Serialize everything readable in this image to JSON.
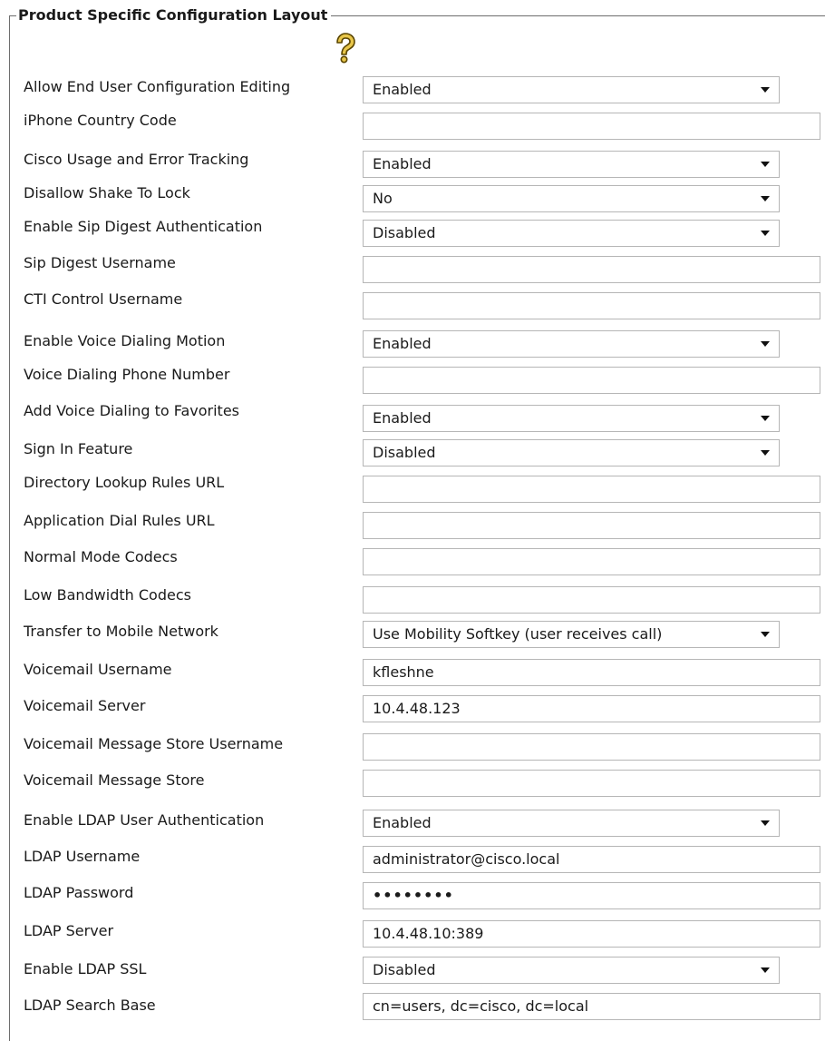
{
  "section": {
    "title": "Product Specific Configuration Layout",
    "help_icon": "question-mark-help-icon"
  },
  "fields": [
    {
      "label": "Allow End User Configuration Editing",
      "type": "select",
      "value": "Enabled"
    },
    {
      "label": "iPhone Country Code",
      "type": "text",
      "value": ""
    },
    {
      "label": "Cisco Usage and Error Tracking",
      "type": "select",
      "value": "Enabled"
    },
    {
      "label": "Disallow Shake To Lock",
      "type": "select",
      "value": "No"
    },
    {
      "label": "Enable Sip Digest Authentication",
      "type": "select",
      "value": "Disabled"
    },
    {
      "label": "Sip Digest Username",
      "type": "text",
      "value": ""
    },
    {
      "label": "CTI Control Username",
      "type": "text",
      "value": ""
    },
    {
      "label": "Enable Voice Dialing Motion",
      "type": "select",
      "value": "Enabled"
    },
    {
      "label": "Voice Dialing Phone Number",
      "type": "text",
      "value": ""
    },
    {
      "label": "Add Voice Dialing to Favorites",
      "type": "select",
      "value": "Enabled"
    },
    {
      "label": "Sign In Feature",
      "type": "select",
      "value": "Disabled"
    },
    {
      "label": "Directory Lookup Rules URL",
      "type": "text",
      "value": ""
    },
    {
      "label": "Application Dial Rules URL",
      "type": "text",
      "value": ""
    },
    {
      "label": "Normal Mode Codecs",
      "type": "text",
      "value": ""
    },
    {
      "label": "Low Bandwidth Codecs",
      "type": "text",
      "value": ""
    },
    {
      "label": "Transfer to Mobile Network",
      "type": "select",
      "value": "Use Mobility Softkey (user receives call)"
    },
    {
      "label": "Voicemail Username",
      "type": "text",
      "value": "kfleshne"
    },
    {
      "label": "Voicemail Server",
      "type": "text",
      "value": "10.4.48.123"
    },
    {
      "label": "Voicemail Message Store Username",
      "type": "text",
      "value": ""
    },
    {
      "label": "Voicemail Message Store",
      "type": "text",
      "value": ""
    },
    {
      "label": "Enable LDAP User Authentication",
      "type": "select",
      "value": "Enabled"
    },
    {
      "label": "LDAP Username",
      "type": "text",
      "value": "administrator@cisco.local"
    },
    {
      "label": "LDAP Password",
      "type": "password",
      "value": "••••••••"
    },
    {
      "label": "LDAP Server",
      "type": "text",
      "value": "10.4.48.10:389"
    },
    {
      "label": "Enable LDAP SSL",
      "type": "select",
      "value": "Disabled"
    },
    {
      "label": "LDAP Search Base",
      "type": "text",
      "value": "cn=users, dc=cisco, dc=local"
    }
  ]
}
